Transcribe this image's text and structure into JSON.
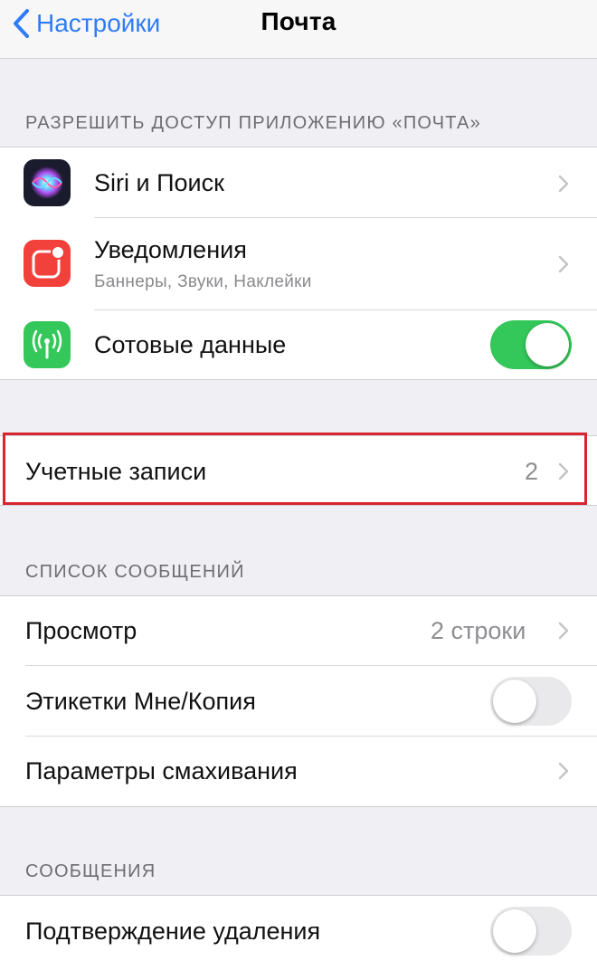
{
  "nav": {
    "back_label": "Настройки",
    "title": "Почта"
  },
  "section_access": {
    "header": "РАЗРЕШИТЬ ДОСТУП ПРИЛОЖЕНИЮ «ПОЧТА»",
    "items": [
      {
        "label": "Siri и Поиск",
        "icon": "siri-icon"
      },
      {
        "label": "Уведомления",
        "sublabel": "Баннеры, Звуки, Наклейки",
        "icon": "notifications-icon",
        "icon_color": "#f2403a"
      },
      {
        "label": "Сотовые данные",
        "icon": "cellular-icon",
        "icon_color": "#34c759",
        "toggle": true
      }
    ]
  },
  "accounts": {
    "label": "Учетные записи",
    "value": "2"
  },
  "section_list": {
    "header": "СПИСОК СООБЩЕНИЙ",
    "items": [
      {
        "label": "Просмотр",
        "value": "2 строки"
      },
      {
        "label": "Этикетки Мне/Копия",
        "toggle": false
      },
      {
        "label": "Параметры смахивания"
      }
    ]
  },
  "section_messages": {
    "header": "СООБЩЕНИЯ",
    "items": [
      {
        "label": "Подтверждение удаления",
        "toggle": false
      }
    ]
  },
  "colors": {
    "accent": "#2f7cf6",
    "toggle_on": "#34c759",
    "highlight": "#d7262e"
  }
}
